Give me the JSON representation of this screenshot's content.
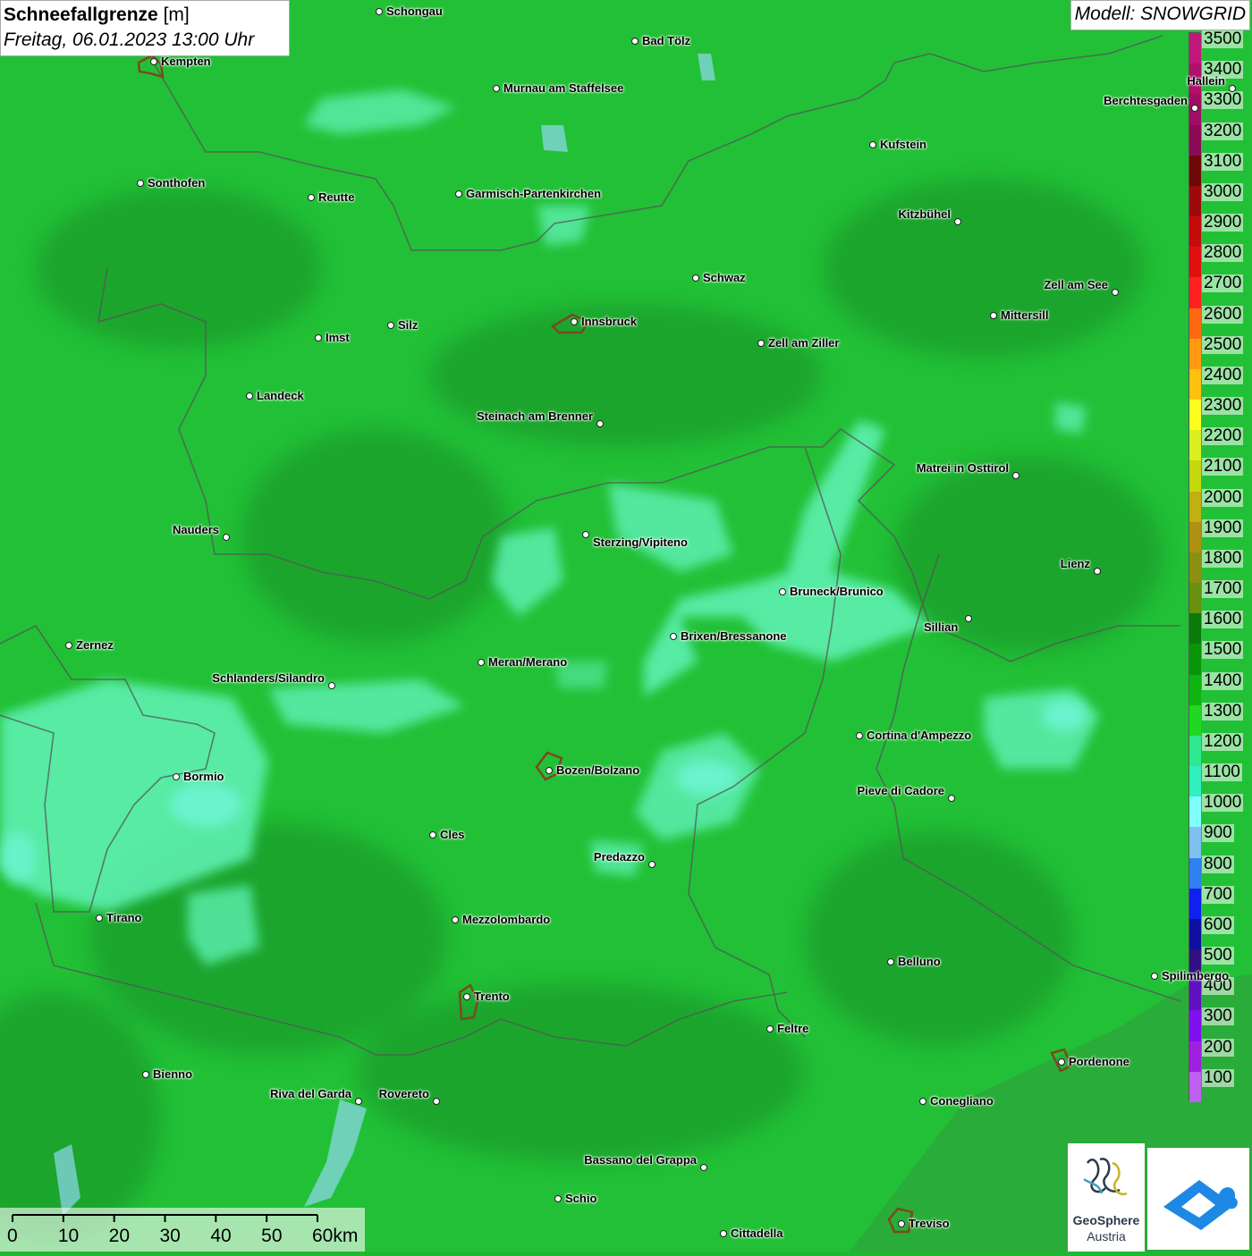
{
  "title": {
    "main": "Schneefallgrenze",
    "unit": "[m]",
    "datetime": "Freitag, 06.01.2023 13:00 Uhr"
  },
  "model": "Modell: SNOWGRID",
  "legend": [
    {
      "label": "3500",
      "color": "#c0187a"
    },
    {
      "label": "3400",
      "color": "#b0106e"
    },
    {
      "label": "3300",
      "color": "#a00d64"
    },
    {
      "label": "3200",
      "color": "#8a0a58"
    },
    {
      "label": "3100",
      "color": "#6e0808"
    },
    {
      "label": "3000",
      "color": "#9e0a0a"
    },
    {
      "label": "2900",
      "color": "#c40c0c"
    },
    {
      "label": "2800",
      "color": "#e01010"
    },
    {
      "label": "2700",
      "color": "#ff2020"
    },
    {
      "label": "2600",
      "color": "#ff6a10"
    },
    {
      "label": "2500",
      "color": "#ff9a10"
    },
    {
      "label": "2400",
      "color": "#ffc010"
    },
    {
      "label": "2300",
      "color": "#ffff20"
    },
    {
      "label": "2200",
      "color": "#d8f020"
    },
    {
      "label": "2100",
      "color": "#c4d810"
    },
    {
      "label": "2000",
      "color": "#c0b010"
    },
    {
      "label": "1900",
      "color": "#b09010"
    },
    {
      "label": "1800",
      "color": "#8c9010"
    },
    {
      "label": "1700",
      "color": "#6a9010"
    },
    {
      "label": "1600",
      "color": "#0a7a0a"
    },
    {
      "label": "1500",
      "color": "#0a940a"
    },
    {
      "label": "1400",
      "color": "#10b410"
    },
    {
      "label": "1300",
      "color": "#20d820"
    },
    {
      "label": "1200",
      "color": "#30e890"
    },
    {
      "label": "1100",
      "color": "#30f0c0"
    },
    {
      "label": "1000",
      "color": "#80ffff"
    },
    {
      "label": "900",
      "color": "#80c0f0"
    },
    {
      "label": "800",
      "color": "#3080f0"
    },
    {
      "label": "700",
      "color": "#1020f0"
    },
    {
      "label": "600",
      "color": "#1010a0"
    },
    {
      "label": "500",
      "color": "#301080"
    },
    {
      "label": "400",
      "color": "#6010c0"
    },
    {
      "label": "300",
      "color": "#8010f0"
    },
    {
      "label": "200",
      "color": "#a020e0"
    },
    {
      "label": "100",
      "color": "#c060f0"
    }
  ],
  "cities": [
    {
      "name": "Schongau"
    },
    {
      "name": "Bad Tölz"
    },
    {
      "name": "Kempten"
    },
    {
      "name": "Murnau am Staffelsee"
    },
    {
      "name": "Hallein"
    },
    {
      "name": "Berchtesgaden"
    },
    {
      "name": "Kufstein"
    },
    {
      "name": "Sonthofen"
    },
    {
      "name": "Reutte"
    },
    {
      "name": "Garmisch-Partenkirchen"
    },
    {
      "name": "Kitzbühel"
    },
    {
      "name": "Schwaz"
    },
    {
      "name": "Zell am See"
    },
    {
      "name": "Innsbruck"
    },
    {
      "name": "Mittersill"
    },
    {
      "name": "Imst"
    },
    {
      "name": "Silz"
    },
    {
      "name": "Zell am Ziller"
    },
    {
      "name": "Landeck"
    },
    {
      "name": "Steinach am Brenner"
    },
    {
      "name": "Matrei in Osttirol"
    },
    {
      "name": "Nauders"
    },
    {
      "name": "Sterzing/Vipiteno"
    },
    {
      "name": "Lienz"
    },
    {
      "name": "Bruneck/Brunico"
    },
    {
      "name": "Sillian"
    },
    {
      "name": "Zernez"
    },
    {
      "name": "Brixen/Bressanone"
    },
    {
      "name": "Meran/Merano"
    },
    {
      "name": "Schlanders/Silandro"
    },
    {
      "name": "Cortina d'Ampezzo"
    },
    {
      "name": "Bozen/Bolzano"
    },
    {
      "name": "Bormio"
    },
    {
      "name": "Pieve di Cadore"
    },
    {
      "name": "Cles"
    },
    {
      "name": "Predazzo"
    },
    {
      "name": "Tirano"
    },
    {
      "name": "Mezzolombardo"
    },
    {
      "name": "Belluno"
    },
    {
      "name": "Spilimbergo"
    },
    {
      "name": "Trento"
    },
    {
      "name": "Feltre"
    },
    {
      "name": "Pordenone"
    },
    {
      "name": "Bienno"
    },
    {
      "name": "Riva del Garda"
    },
    {
      "name": "Rovereto"
    },
    {
      "name": "Conegliano"
    },
    {
      "name": "Bassano del Grappa"
    },
    {
      "name": "Schio"
    },
    {
      "name": "Treviso"
    },
    {
      "name": "Cittadella"
    }
  ],
  "scale": {
    "labels": [
      "0",
      "10",
      "20",
      "30",
      "40",
      "50",
      "60km"
    ]
  },
  "logo": {
    "name_line1": "GeoSphere",
    "name_line2": "Austria"
  }
}
